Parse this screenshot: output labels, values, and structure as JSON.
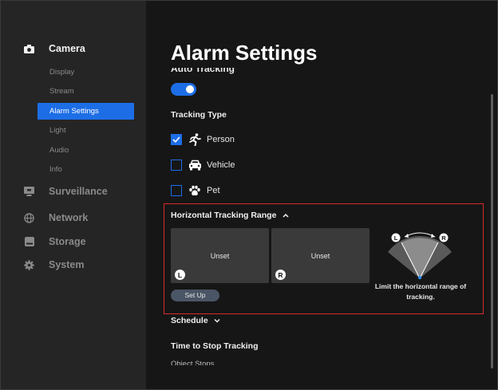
{
  "sidebar": {
    "camera": "Camera",
    "camera_items": [
      "Display",
      "Stream",
      "Alarm Settings",
      "Light",
      "Audio",
      "Info"
    ],
    "selected_item": "Alarm Settings",
    "surveillance": "Surveillance",
    "network": "Network",
    "storage": "Storage",
    "system": "System"
  },
  "main": {
    "title": "Alarm Settings",
    "partial_heading": "Auto Tracking",
    "auto_tracking_enabled": true,
    "tracking_type": {
      "heading": "Tracking Type",
      "options": [
        {
          "label": "Person",
          "checked": true,
          "icon": "person-running-icon"
        },
        {
          "label": "Vehicle",
          "checked": false,
          "icon": "car-icon"
        },
        {
          "label": "Pet",
          "checked": false,
          "icon": "paw-icon"
        }
      ]
    },
    "range": {
      "heading": "Horizontal Tracking Range",
      "left_tile": "Unset",
      "right_tile": "Unset",
      "left_badge": "L",
      "right_badge": "R",
      "setup_button": "Set Up",
      "hint": "Limit the horizontal range of tracking."
    },
    "schedule": "Schedule",
    "time_to_stop": "Time to Stop Tracking",
    "object_stops": "Object Stops"
  },
  "colors": {
    "accent": "#1d6ee6",
    "highlight_border": "#d62a2a",
    "sidebar_bg": "#252525",
    "main_bg": "#161616"
  }
}
